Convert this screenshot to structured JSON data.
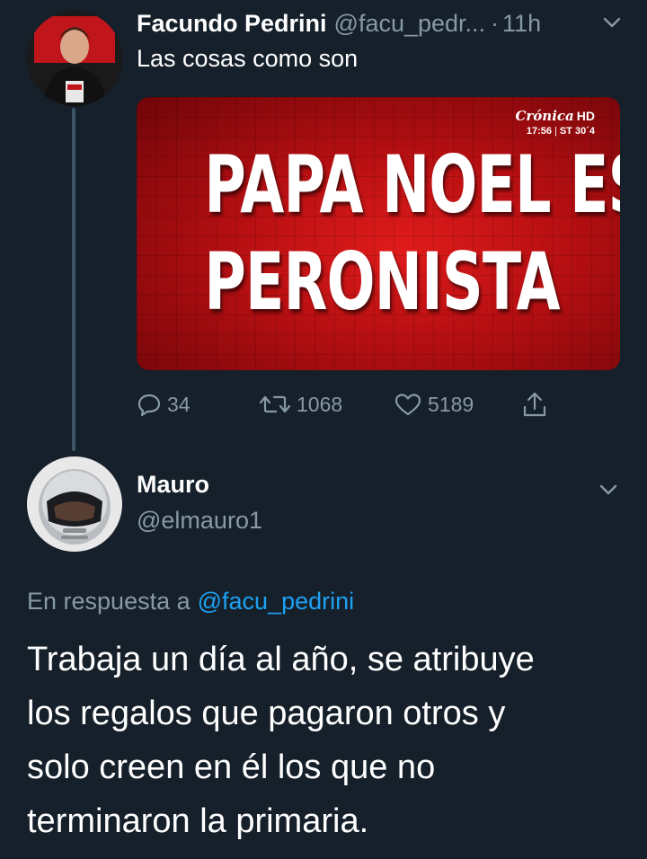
{
  "tweet1": {
    "name": "Facundo Pedrini",
    "handle": "@facu_pedr...",
    "separator": "·",
    "time": "11h",
    "text": "Las cosas como son",
    "media": {
      "headline_line1": "PAPA NOEL ES",
      "headline_line2": "PERONISTA",
      "logo_brand": "Crónica",
      "logo_hd": "HD",
      "logo_clock": "17:56",
      "logo_st": "ST",
      "logo_temp": "30´4"
    },
    "actions": {
      "replies": "34",
      "retweets": "1068",
      "likes": "5189"
    }
  },
  "tweet2": {
    "name": "Mauro",
    "handle": "@elmauro1",
    "reply_prefix": "En respuesta a",
    "reply_mention": "@facu_pedrini",
    "body_lines": [
      "Trabaja un día al año, se atribuye",
      "los regalos que pagaron otros y",
      "solo creen en él los que no",
      "terminaron la primaria."
    ]
  },
  "icons": {
    "reply": "speech-bubble-icon",
    "retweet": "retweet-arrows-icon",
    "like": "heart-icon",
    "share": "upload-arrow-icon",
    "menu": "chevron-down-icon"
  },
  "colors": {
    "background": "#15202b",
    "secondary_text": "#8899a6",
    "link": "#1da1f2",
    "media_red": "#d0161a"
  }
}
